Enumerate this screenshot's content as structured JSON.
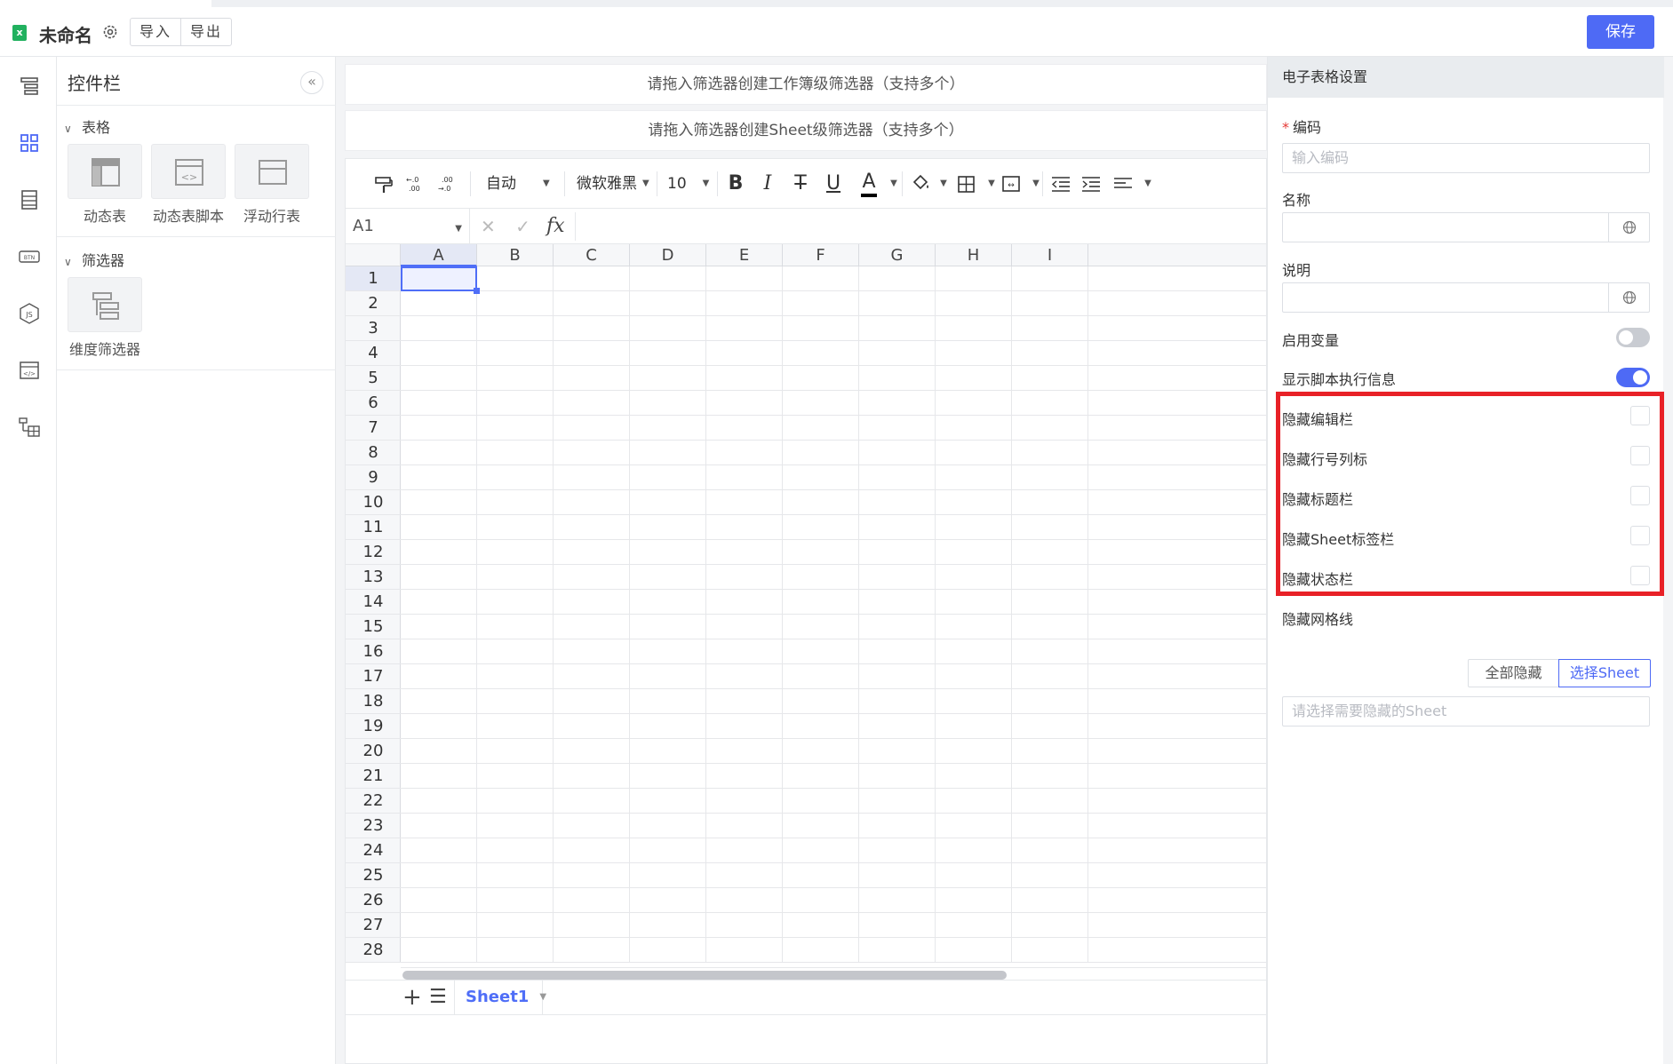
{
  "header": {
    "file_icon": "spreadsheet-file-icon",
    "title": "未命名",
    "import_label": "导入",
    "export_label": "导出",
    "save_label": "保存",
    "accent_color": "#4e6af5"
  },
  "rail": {
    "icons": [
      "layout-tree-icon",
      "grid-apps-icon",
      "list-table-icon",
      "btn-component-icon",
      "js-hexagon-icon",
      "code-window-icon",
      "hierarchy-table-icon"
    ]
  },
  "widgets": {
    "title": "控件栏",
    "groups": [
      {
        "label": "表格",
        "items": [
          {
            "label": "动态表"
          },
          {
            "label": "动态表脚本"
          },
          {
            "label": "浮动行表"
          }
        ]
      },
      {
        "label": "筛选器",
        "items": [
          {
            "label": "维度筛选器"
          }
        ]
      }
    ]
  },
  "canvas": {
    "workbook_filter_hint": "请拖入筛选器创建工作簿级筛选器（支持多个）",
    "sheet_filter_hint": "请拖入筛选器创建Sheet级筛选器（支持多个）"
  },
  "toolbar": {
    "number_format": "自动",
    "font_family": "微软雅黑",
    "font_size": "10",
    "bold": "B",
    "italic": "I",
    "strikethrough": "T",
    "underline": "U",
    "font_color": "A",
    "font_color_value": "#000000"
  },
  "formula_bar": {
    "cell_ref": "A1",
    "fx": "fx"
  },
  "grid": {
    "columns": [
      "A",
      "B",
      "C",
      "D",
      "E",
      "F",
      "G",
      "H",
      "I"
    ],
    "rows": [
      "1",
      "2",
      "3",
      "4",
      "5",
      "6",
      "7",
      "8",
      "9",
      "10",
      "11",
      "12",
      "13",
      "14",
      "15",
      "16",
      "17",
      "18",
      "19",
      "20",
      "21",
      "22",
      "23",
      "24",
      "25",
      "26",
      "27",
      "28"
    ],
    "selected_cell": "A1"
  },
  "sheets": {
    "active": "Sheet1"
  },
  "settings": {
    "title": "电子表格设置",
    "code_label": "编码",
    "code_placeholder": "输入编码",
    "name_label": "名称",
    "desc_label": "说明",
    "enable_vars_label": "启用变量",
    "enable_vars": false,
    "show_script_info_label": "显示脚本执行信息",
    "show_script_info": true,
    "hide_options": [
      {
        "label": "隐藏编辑栏",
        "checked": false
      },
      {
        "label": "隐藏行号列标",
        "checked": false
      },
      {
        "label": "隐藏标题栏",
        "checked": false
      },
      {
        "label": "隐藏Sheet标签栏",
        "checked": false
      },
      {
        "label": "隐藏状态栏",
        "checked": false
      }
    ],
    "gridlines_label": "隐藏网格线",
    "gridlines_all": "全部隐藏",
    "gridlines_select": "选择Sheet",
    "gridlines_active": "选择Sheet",
    "sheet_select_placeholder": "请选择需要隐藏的Sheet",
    "highlight_color": "#e82127"
  }
}
